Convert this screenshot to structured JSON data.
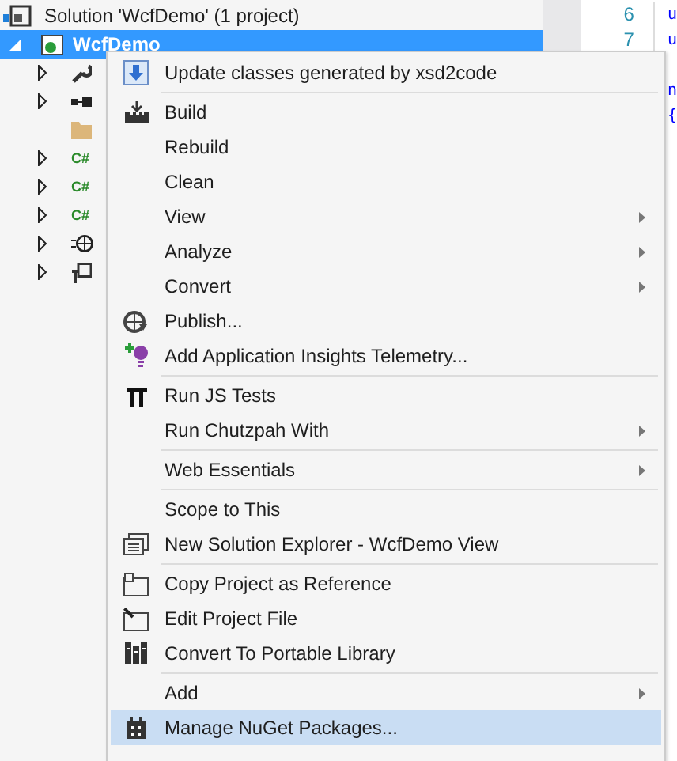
{
  "solution_explorer": {
    "solution": {
      "label": "Solution 'WcfDemo' (1 project)"
    },
    "project": {
      "label": "WcfDemo",
      "selected": true,
      "expanded": true
    },
    "children": [
      {
        "kind": "wrench",
        "expandable": true
      },
      {
        "kind": "refs",
        "expandable": true
      },
      {
        "kind": "folder",
        "expandable": false
      },
      {
        "kind": "csharp",
        "badge": "C#",
        "expandable": true
      },
      {
        "kind": "csharp",
        "badge": "C#",
        "expandable": true
      },
      {
        "kind": "csharp",
        "badge": "C#",
        "expandable": true
      },
      {
        "kind": "globe",
        "expandable": true
      },
      {
        "kind": "config",
        "expandable": true
      }
    ]
  },
  "editor": {
    "lines": [
      {
        "number": "6",
        "code": "u",
        "gap_before": false
      },
      {
        "number": "7",
        "code": "u",
        "gap_before": false
      },
      {
        "code": "n",
        "gap_before": true
      },
      {
        "code": "{",
        "gap_before": false
      }
    ]
  },
  "context_menu": {
    "items": [
      {
        "kind": "item",
        "label": "Update classes generated by xsd2code",
        "submenu": false,
        "selected": false
      },
      {
        "kind": "separator"
      },
      {
        "kind": "item",
        "label": "Build",
        "submenu": false,
        "selected": false
      },
      {
        "kind": "item",
        "label": "Rebuild",
        "submenu": false,
        "selected": false
      },
      {
        "kind": "item",
        "label": "Clean",
        "submenu": false,
        "selected": false
      },
      {
        "kind": "item",
        "label": "View",
        "submenu": true,
        "selected": false
      },
      {
        "kind": "item",
        "label": "Analyze",
        "submenu": true,
        "selected": false
      },
      {
        "kind": "item",
        "label": "Convert",
        "submenu": true,
        "selected": false
      },
      {
        "kind": "item",
        "label": "Publish...",
        "submenu": false,
        "selected": false
      },
      {
        "kind": "item",
        "label": "Add Application Insights Telemetry...",
        "submenu": false,
        "selected": false
      },
      {
        "kind": "separator"
      },
      {
        "kind": "item",
        "label": "Run JS Tests",
        "submenu": false,
        "selected": false
      },
      {
        "kind": "item",
        "label": "Run Chutzpah With",
        "submenu": true,
        "selected": false
      },
      {
        "kind": "separator"
      },
      {
        "kind": "item",
        "label": "Web Essentials",
        "submenu": true,
        "selected": false
      },
      {
        "kind": "separator"
      },
      {
        "kind": "item",
        "label": "Scope to This",
        "submenu": false,
        "selected": false
      },
      {
        "kind": "item",
        "label": "New Solution Explorer - WcfDemo View",
        "submenu": false,
        "selected": false
      },
      {
        "kind": "separator"
      },
      {
        "kind": "item",
        "label": "Copy Project as Reference",
        "submenu": false,
        "selected": false
      },
      {
        "kind": "item",
        "label": "Edit Project File",
        "submenu": false,
        "selected": false
      },
      {
        "kind": "item",
        "label": "Convert To Portable Library",
        "submenu": false,
        "selected": false
      },
      {
        "kind": "separator"
      },
      {
        "kind": "item",
        "label": "Add",
        "submenu": true,
        "selected": false
      },
      {
        "kind": "item",
        "label": "Manage NuGet Packages...",
        "submenu": false,
        "selected": true
      }
    ]
  }
}
